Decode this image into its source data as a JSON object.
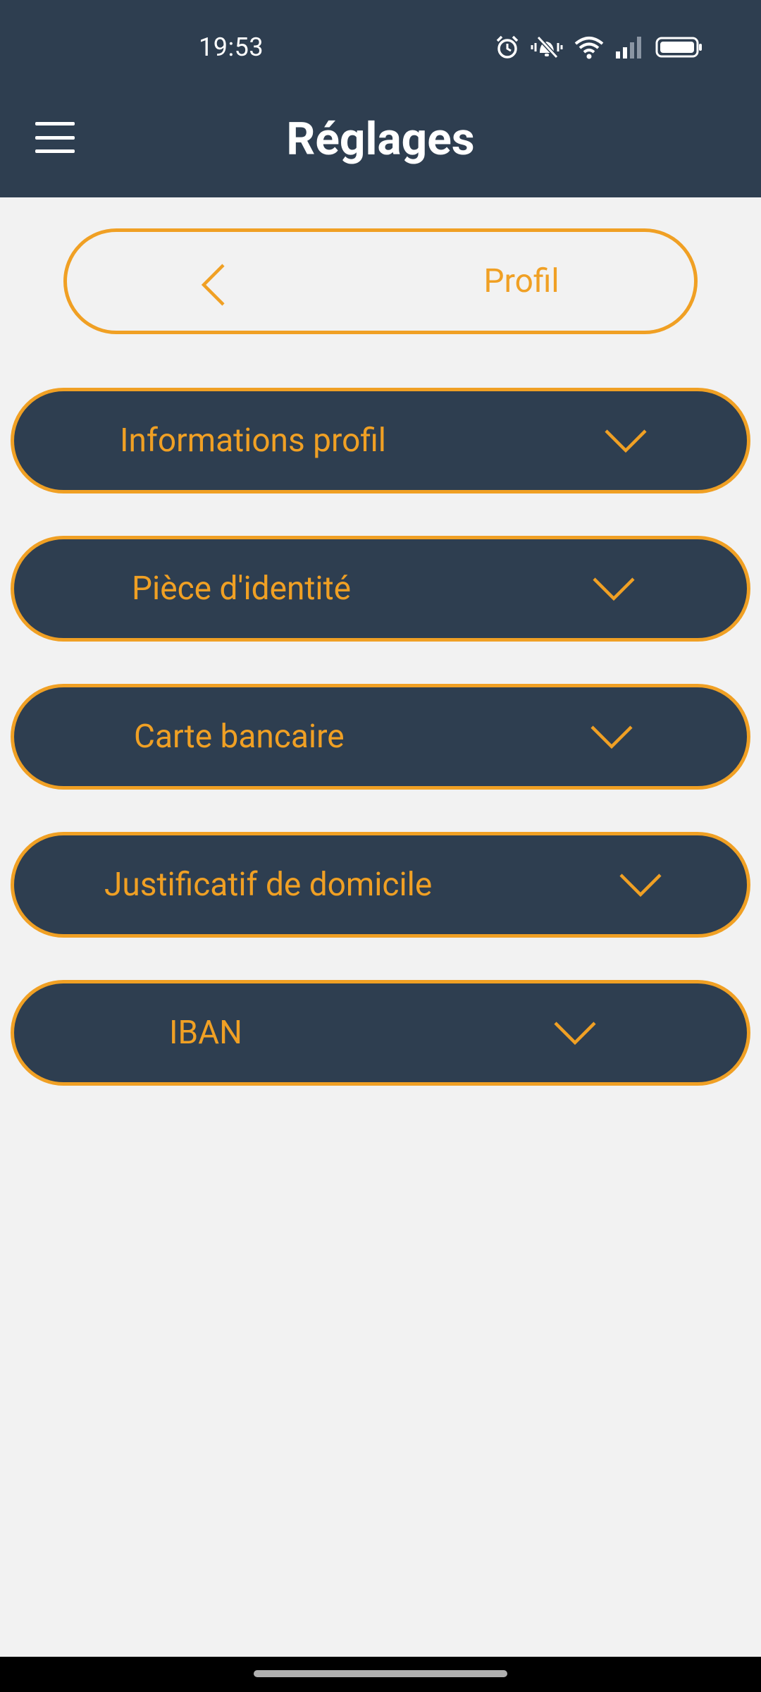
{
  "status_bar": {
    "time": "19:53",
    "icons": [
      "alarm-icon",
      "vibrate-silent-icon",
      "wifi-icon",
      "signal-icon",
      "battery-icon"
    ]
  },
  "header": {
    "title": "Réglages",
    "menu_icon": "hamburger-menu-icon"
  },
  "back_button": {
    "label": "Profil",
    "icon": "chevron-left-icon"
  },
  "sections": [
    {
      "label": "Informations profil",
      "icon": "chevron-down-icon"
    },
    {
      "label": "Pièce d'identité",
      "icon": "chevron-down-icon"
    },
    {
      "label": "Carte bancaire",
      "icon": "chevron-down-icon"
    },
    {
      "label": "Justificatif de domicile",
      "icon": "chevron-down-icon"
    },
    {
      "label": "IBAN",
      "icon": "chevron-down-icon"
    }
  ],
  "colors": {
    "primary": "#2e3e50",
    "accent": "#f0a024",
    "background": "#f2f2f2"
  }
}
